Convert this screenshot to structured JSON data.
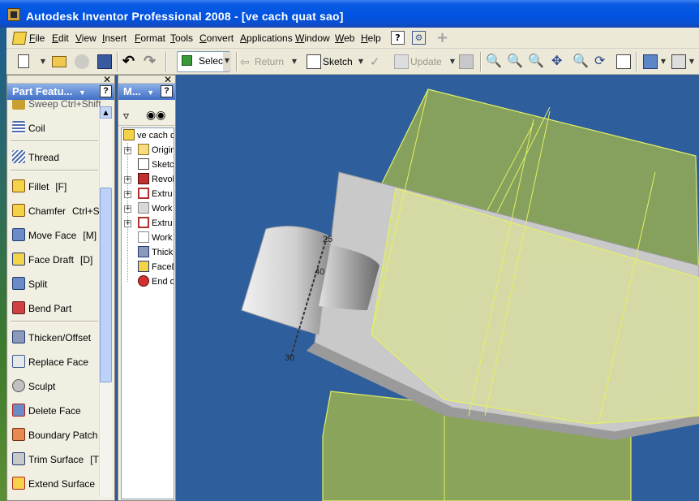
{
  "window": {
    "title": "Autodesk Inventor Professional 2008 - [ve cach quat sao]"
  },
  "menubar": {
    "items": [
      "File",
      "Edit",
      "View",
      "Insert",
      "Format",
      "Tools",
      "Convert",
      "Applications",
      "Window",
      "Web",
      "Help"
    ]
  },
  "toolbar": {
    "select_label": "Select",
    "return_label": "Return",
    "sketch_label": "Sketch",
    "update_label": "Update"
  },
  "part_panel": {
    "title": "Part Featu...",
    "partial_item": "Sweep    Ctrl+Shift",
    "features": [
      {
        "label": "Coil",
        "shortcut": "",
        "icon": "coil-icon"
      },
      {
        "label": "Thread",
        "shortcut": "",
        "icon": "thread-icon"
      },
      {
        "label": "Fillet",
        "shortcut": "[F]",
        "icon": "fillet-icon"
      },
      {
        "label": "Chamfer",
        "shortcut": "Ctrl+Sh",
        "icon": "chamfer-icon"
      },
      {
        "label": "Move Face",
        "shortcut": "[M]",
        "icon": "move-face-icon"
      },
      {
        "label": "Face Draft",
        "shortcut": "[D]",
        "icon": "face-draft-icon"
      },
      {
        "label": "Split",
        "shortcut": "",
        "icon": "split-icon"
      },
      {
        "label": "Bend Part",
        "shortcut": "",
        "icon": "bend-part-icon"
      },
      {
        "label": "Thicken/Offset",
        "shortcut": "",
        "icon": "thicken-icon"
      },
      {
        "label": "Replace Face",
        "shortcut": "",
        "icon": "replace-face-icon"
      },
      {
        "label": "Sculpt",
        "shortcut": "",
        "icon": "sculpt-icon"
      },
      {
        "label": "Delete Face",
        "shortcut": "",
        "icon": "delete-face-icon"
      },
      {
        "label": "Boundary Patch",
        "shortcut": "",
        "icon": "boundary-patch-icon"
      },
      {
        "label": "Trim Surface",
        "shortcut": "[T]",
        "icon": "trim-surface-icon"
      },
      {
        "label": "Extend Surface",
        "shortcut": "",
        "icon": "extend-surface-icon"
      }
    ]
  },
  "browser_panel": {
    "title": "M...",
    "root": "ve cach q",
    "nodes": [
      {
        "label": "Origin",
        "icon": "folder-icon"
      },
      {
        "label": "Sketch",
        "icon": "sketch-icon"
      },
      {
        "label": "Revol",
        "icon": "revolve-icon"
      },
      {
        "label": "Extru",
        "icon": "extrude-icon"
      },
      {
        "label": "Work",
        "icon": "work-plane-icon"
      },
      {
        "label": "Extru",
        "icon": "extrude-icon"
      },
      {
        "label": "Work",
        "icon": "work-plane-icon"
      },
      {
        "label": "Thick",
        "icon": "thicken-icon"
      },
      {
        "label": "FaceD",
        "icon": "face-draft-icon"
      },
      {
        "label": "End o",
        "icon": "end-of-part-icon"
      }
    ]
  },
  "viewport": {
    "dimension_labels": [
      "25",
      "40",
      "30"
    ]
  },
  "colors": {
    "viewport_bg": "#2e5f9c",
    "surface_yellow": "#e4f07a",
    "part_gray": "#c9c9c9"
  }
}
